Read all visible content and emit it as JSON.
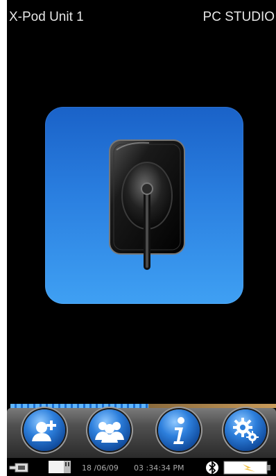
{
  "header": {
    "device_name": "X-Pod Unit 1",
    "mode": "PC STUDIO"
  },
  "main_tile": {
    "icon": "dental-sensor-icon"
  },
  "progress": {
    "fraction": 0.52
  },
  "dock": {
    "buttons": [
      {
        "icon": "add-patient-icon"
      },
      {
        "icon": "patients-icon"
      },
      {
        "icon": "info-icon"
      },
      {
        "icon": "settings-icon"
      }
    ]
  },
  "status": {
    "date": "18 /06/09",
    "time": "03 :34:34 PM",
    "icons": [
      "usb-icon",
      "memory-card-icon",
      "bluetooth-icon",
      "battery-charging-icon"
    ],
    "colors": {
      "bluetooth_bg": "#ffffff",
      "battery_fill": "#ffffff",
      "battery_bolt": "#f0c040"
    }
  },
  "colors": {
    "background": "#000000",
    "tile": "#2a7fe0",
    "dock": "#505050",
    "progress": "#5fb6ff"
  }
}
